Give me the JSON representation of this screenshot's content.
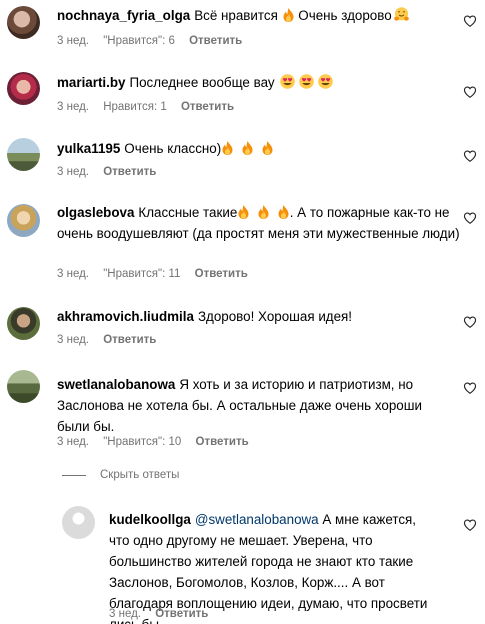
{
  "comments": [
    {
      "username": "nochnaya_fyria_olga",
      "text_parts": [
        "Всё нравится",
        "Очень здорово"
      ],
      "time": "3 нед.",
      "likes": "\"Нравится\": 6",
      "reply": "Ответить"
    },
    {
      "username": "mariarti.by",
      "text": "Последнее вообще вау",
      "time": "3 нед.",
      "likes": "Нравится: 1",
      "reply": "Ответить"
    },
    {
      "username": "yulka1195",
      "text": "Очень классно)",
      "time": "3 нед.",
      "reply": "Ответить"
    },
    {
      "username": "olgaslebova",
      "text_before": "Классные такие",
      "text_after": ". А то пожарные как-то не очень воодушевляют (да простят меня эти мужественные люди)",
      "time": "3 нед.",
      "likes": "\"Нравится\": 11",
      "reply": "Ответить"
    },
    {
      "username": "akhramovich.liudmila",
      "text": "Здорово! Хорошая идея!",
      "time": "3 нед.",
      "reply": "Ответить"
    },
    {
      "username": "swetlanalobanowa",
      "text": "Я хоть и за историю и патриотизм, но Заслонова не хотела бы. А остальные даже очень хороши были бы.",
      "time": "3 нед.",
      "likes": "\"Нравится\": 10",
      "reply": "Ответить"
    }
  ],
  "hide_replies": "Скрыть ответы",
  "reply": {
    "username": "kudelkoollga",
    "mention": "@swetlanalobanowa",
    "text": "А мне кажется, что одно другому не мешает. Уверена, что большинство жителей города не знают кто такие Заслонов, Богомолов, Козлов, Корж.... А вот благодаря воплощению идеи, думаю, что просвети лись бы.",
    "time": "3 нед.",
    "reply": "Ответить"
  },
  "icons": {
    "like": "heart-outline-icon",
    "fire": "fire-emoji",
    "hug": "hugging-face-emoji",
    "heart_eyes": "heart-eyes-emoji"
  },
  "colors": {
    "meta": "#737373",
    "mention": "#00376b"
  }
}
